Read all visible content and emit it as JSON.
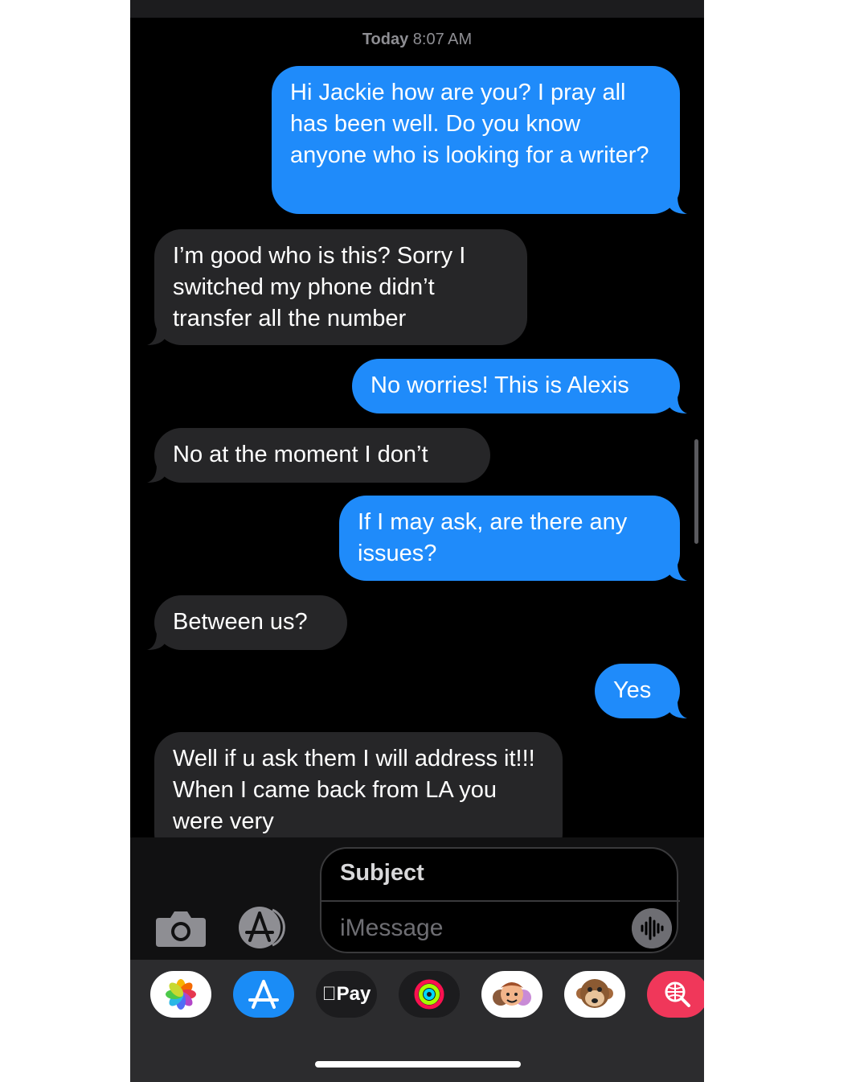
{
  "thread": {
    "timestamp_day": "Today",
    "timestamp_time": "8:07 AM",
    "messages": [
      {
        "dir": "sent",
        "text": "Hi Jackie how are you? I pray all has been well. Do you know anyone who is looking for a writer?"
      },
      {
        "dir": "received",
        "text": "I’m good who is this? Sorry I switched my phone didn’t transfer all the number"
      },
      {
        "dir": "sent",
        "text": "No worries! This is Alexis"
      },
      {
        "dir": "received",
        "text": "No at the moment I don’t"
      },
      {
        "dir": "sent",
        "text": "If I may ask, are there any issues?"
      },
      {
        "dir": "received",
        "text": "Between us?"
      },
      {
        "dir": "sent",
        "text": "Yes"
      },
      {
        "dir": "received",
        "text": "Well if u ask them I will address it!!! When I came back from LA you were very"
      }
    ]
  },
  "compose": {
    "subject_placeholder": "Subject",
    "message_placeholder": "iMessage",
    "camera_icon": "camera-icon",
    "apps_icon": "app-store-icon",
    "voice_icon": "waveform-icon"
  },
  "app_drawer": {
    "apps": [
      {
        "name": "photos-app-icon",
        "bg": "#ffffff"
      },
      {
        "name": "app-store-app-icon",
        "bg": "#1a8cf6"
      },
      {
        "name": "apple-pay-app-icon",
        "bg": "#1c1c1e",
        "label": "Pay"
      },
      {
        "name": "activity-app-icon",
        "bg": "#1c1c1e"
      },
      {
        "name": "memoji-app-icon",
        "bg": "#ffffff"
      },
      {
        "name": "animoji-monkey-app-icon",
        "bg": "#ffffff"
      },
      {
        "name": "web-images-app-icon",
        "bg": "#f0375a"
      }
    ]
  },
  "colors": {
    "sent_bubble": "#1f8bfa",
    "received_bubble": "#262628",
    "background": "#000000"
  }
}
